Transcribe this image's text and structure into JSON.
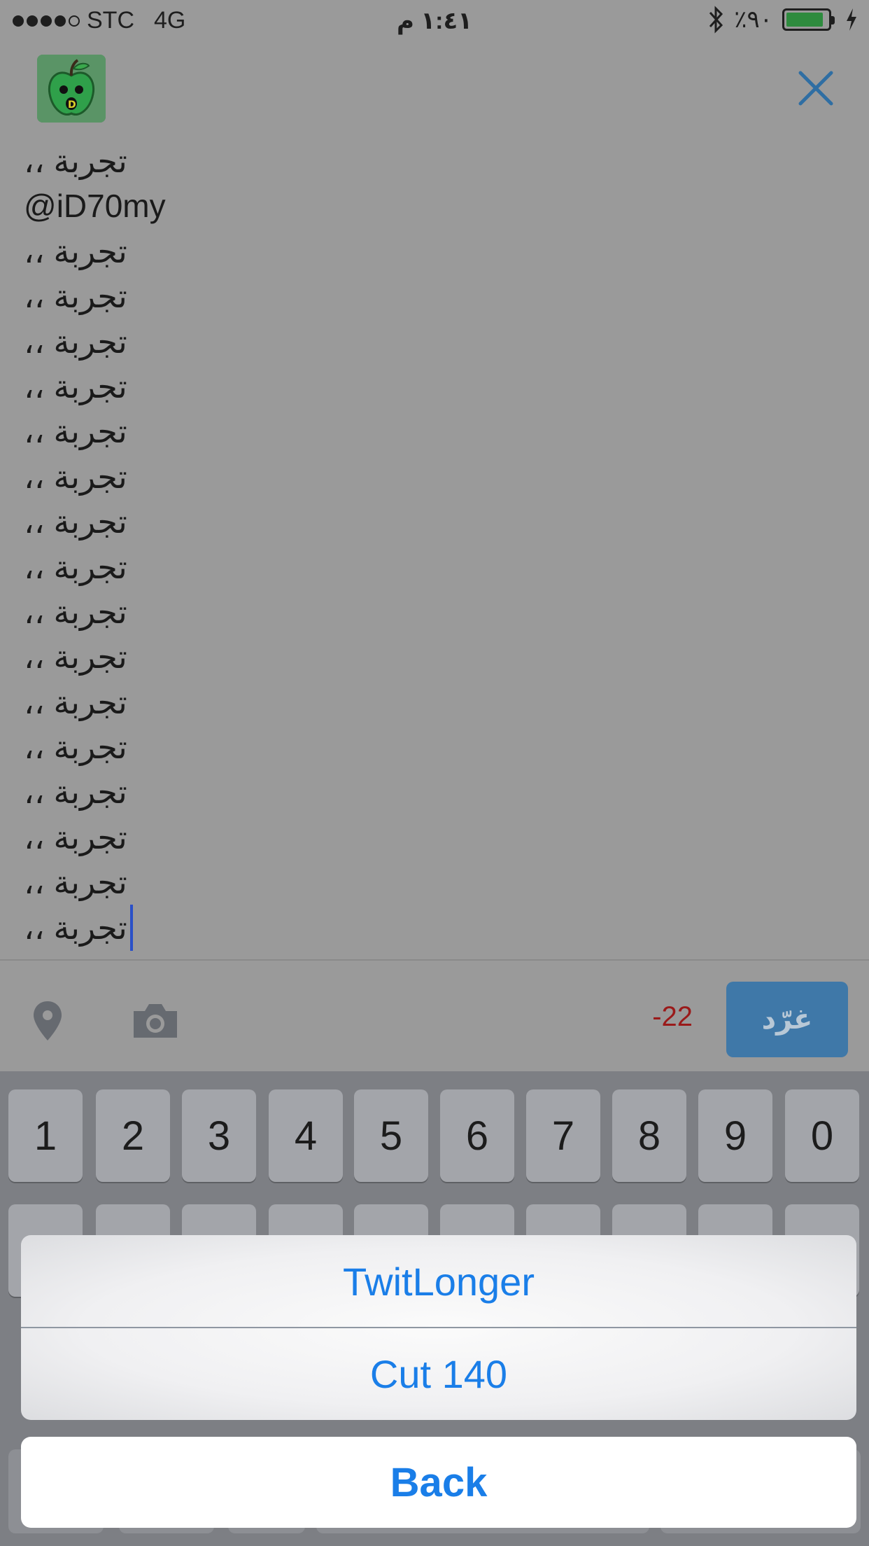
{
  "status_bar": {
    "carrier": "STC",
    "network": "4G",
    "time": "١:٤١ م",
    "battery_percent": "٪٩٠",
    "battery_level": 0.9,
    "battery_color": "#2e8b3e"
  },
  "header": {
    "avatar_icon": "apple-avatar-icon",
    "close_icon": "close-icon"
  },
  "tweet": {
    "lines": [
      "،، تجربة",
      "@iD70my",
      "،، تجربة",
      "،، تجربة",
      "،، تجربة",
      "،، تجربة",
      "،، تجربة",
      "،، تجربة",
      "،، تجربة",
      "،، تجربة",
      "،، تجربة",
      "،، تجربة",
      "،، تجربة",
      "،، تجربة",
      "،، تجربة",
      "،، تجربة",
      "،، تجربة",
      "،، تجربة"
    ]
  },
  "toolbar": {
    "location_icon": "location-pin-icon",
    "camera_icon": "camera-icon",
    "char_count": "-22",
    "send_label": "غرّد",
    "send_color": "#3f78a8"
  },
  "keyboard": {
    "number_keys": [
      "1",
      "2",
      "3",
      "4",
      "5",
      "6",
      "7",
      "8",
      "9",
      "0"
    ]
  },
  "action_sheet": {
    "options": [
      "TwitLonger",
      "Cut 140"
    ],
    "back_label": "Back",
    "accent_color": "#1a7ee8"
  }
}
